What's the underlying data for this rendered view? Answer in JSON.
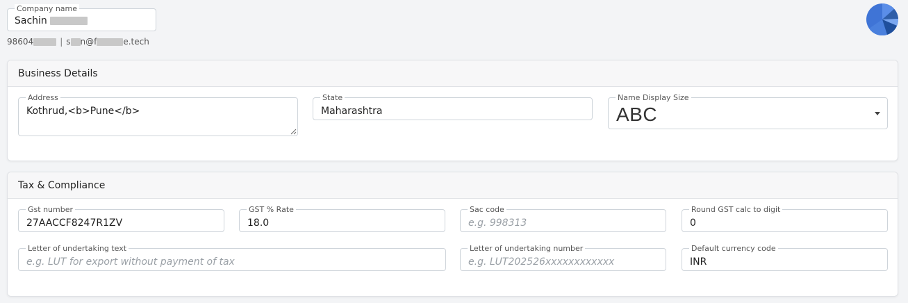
{
  "header": {
    "company_label": "Company name",
    "company_value": "Sachin",
    "phone_prefix": "98604",
    "separator": "|",
    "email_part1": "s",
    "email_part2": "n@f",
    "email_part3": "e.tech"
  },
  "avatar": {
    "icon": "pie-avatar-icon",
    "colors": [
      "#3f74d6",
      "#2f5ea8",
      "#5b8ee8",
      "#7aa7f0",
      "#1f4f9c"
    ]
  },
  "business": {
    "title": "Business Details",
    "address": {
      "label": "Address",
      "value": "Kothrud,<b>Pune</b>"
    },
    "state": {
      "label": "State",
      "value": "Maharashtra"
    },
    "name_display_size": {
      "label": "Name Display Size",
      "value": "ABC"
    }
  },
  "tax": {
    "title": "Tax & Compliance",
    "gst_number": {
      "label": "Gst number",
      "value": "27AACCF8247R1ZV"
    },
    "gst_rate": {
      "label": "GST % Rate",
      "value": "18.0"
    },
    "sac_code": {
      "label": "Sac code",
      "placeholder": "e.g. 998313"
    },
    "round_gst": {
      "label": "Round GST calc to digit",
      "value": "0"
    },
    "lut_text": {
      "label": "Letter of undertaking text",
      "placeholder": "e.g. LUT for export without payment of tax"
    },
    "lut_number": {
      "label": "Letter of undertaking number",
      "placeholder": "e.g. LUT202526xxxxxxxxxxxx"
    },
    "currency": {
      "label": "Default currency code",
      "value": "INR"
    }
  }
}
